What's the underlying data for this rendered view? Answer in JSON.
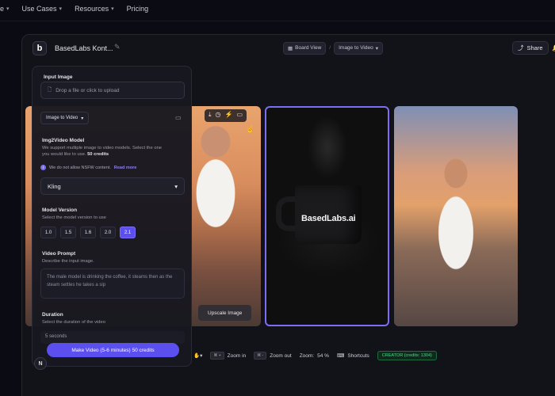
{
  "site_nav": {
    "items": [
      {
        "label": "e",
        "has_caret": true
      },
      {
        "label": "Use Cases",
        "has_caret": true
      },
      {
        "label": "Resources",
        "has_caret": true
      },
      {
        "label": "Pricing",
        "has_caret": false
      }
    ]
  },
  "topbar": {
    "project_title": "BasedLabs Kont...",
    "view_mode": "Board View",
    "view_separator": "/",
    "tool": "Image to Video",
    "share_label": "Share"
  },
  "panel": {
    "input_image_label": "Input Image",
    "upload_placeholder": "Drop a file or click to upload",
    "mode_select": "Image to Video",
    "model_section_label": "Img2Video Model",
    "model_section_desc_1": "We support multiple image to video models. Select the one",
    "model_section_desc_2": "you would like to use.",
    "model_section_credits": "50 credits",
    "nsfw_notice": "We do not allow NSFW content.",
    "read_more": "Read more",
    "model_selected": "Kling",
    "version_label": "Model Version",
    "version_desc": "Select the model version to use",
    "versions": [
      "1.0",
      "1.5",
      "1.6",
      "2.0",
      "2.1"
    ],
    "version_active": "2.1",
    "prompt_label": "Video Prompt",
    "prompt_desc": "Describe the input image.",
    "prompt_value": "The male model is drinking the coffee, it steams then as the steam settles he takes a sip",
    "duration_label": "Duration",
    "duration_desc": "Select the duration of the video",
    "duration_value": "5 seconds",
    "make_button": "Make Video (5-6 minutes) 50 credits"
  },
  "canvas": {
    "mug_text": "BasedLabs.ai",
    "upscale_button": "Upscale Image"
  },
  "bottombar": {
    "zoom_in_key": "⌘ +",
    "zoom_in_label": "Zoom in",
    "zoom_out_key": "⌘ -",
    "zoom_out_label": "Zoom out",
    "zoom_label": "Zoom:",
    "zoom_value": "54 %",
    "shortcuts_label": "Shortcuts",
    "credits_badge": "CREATOR (credits: 1304)"
  },
  "footer": {
    "badge_letter": "N"
  },
  "colors": {
    "accent": "#5b4ff0",
    "selected_border": "#7b6ef5",
    "credits_green": "#4ad58a",
    "background": "#0b0b14"
  },
  "icons": [
    "pencil-icon",
    "share-icon",
    "bell-icon",
    "file-icon",
    "panel-icon",
    "info-icon",
    "chevron-down-icon",
    "download-icon",
    "clock-icon",
    "bolt-icon",
    "video-icon",
    "hand-icon",
    "keyboard-icon"
  ]
}
